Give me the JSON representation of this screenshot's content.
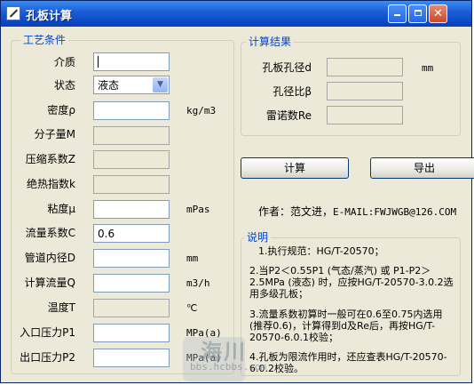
{
  "window": {
    "title": "孔板计算"
  },
  "process": {
    "group_title": "工艺条件",
    "medium": {
      "label": "介质",
      "value": ""
    },
    "state": {
      "label": "状态",
      "value": "液态"
    },
    "density": {
      "label": "密度ρ",
      "value": "",
      "unit": "kg/m3"
    },
    "molweight": {
      "label": "分子量M",
      "value": ""
    },
    "compress": {
      "label": "压缩系数Z",
      "value": ""
    },
    "adiabatic": {
      "label": "绝热指数k",
      "value": ""
    },
    "viscosity": {
      "label": "粘度μ",
      "value": "",
      "unit": "mPas"
    },
    "flowcoef": {
      "label": "流量系数C",
      "value": "0.6"
    },
    "pipediam": {
      "label": "管道内径D",
      "value": "",
      "unit": "mm"
    },
    "flow": {
      "label": "计算流量Q",
      "value": "",
      "unit": "m3/h"
    },
    "temp": {
      "label": "温度T",
      "value": "",
      "unit": "℃"
    },
    "p1": {
      "label": "入口压力P1",
      "value": "",
      "unit": "MPa(a)"
    },
    "p2": {
      "label": "出口压力P2",
      "value": "",
      "unit": "MPa(a)"
    }
  },
  "results": {
    "group_title": "计算结果",
    "diameter": {
      "label": "孔板孔径d",
      "value": "",
      "unit": "mm"
    },
    "ratio": {
      "label": "孔径比β",
      "value": ""
    },
    "reynolds": {
      "label": "雷诺数Re",
      "value": ""
    }
  },
  "buttons": {
    "calc": "计算",
    "export": "导出"
  },
  "author": {
    "prefix": "作者：范文进，",
    "email": "E-MAIL:FWJWGB@126.COM"
  },
  "notes": {
    "group_title": "说明",
    "item1": "1.执行规范：HG/T-20570；",
    "item2": "2.当P2＜0.55P1 (气态/蒸汽) 或 P1-P2＞2.5MPa (液态) 时，应按HG/T-20570-3.0.2选用多级孔板；",
    "item3": "3.流量系数初算时一般可在0.6至0.75内选用 (推荐0.6)，计算得到d及Re后，再按HG/T-20570-6.0.1校验；",
    "item4": "4.孔板为限流作用时，还应查表HG/T-20570-6.0.2校验。"
  },
  "watermark": {
    "text": "海川",
    "url": "bbs.hcbbs.com"
  }
}
